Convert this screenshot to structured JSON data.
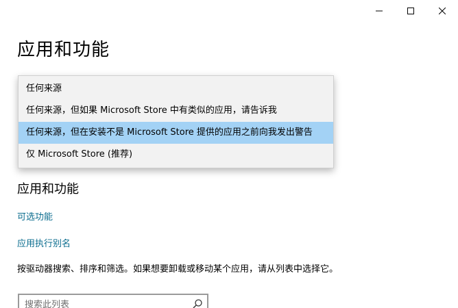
{
  "window": {
    "controls": [
      "minimize",
      "maximize",
      "close"
    ]
  },
  "page": {
    "title": "应用和功能"
  },
  "dropdown": {
    "options": [
      {
        "label": "任何来源",
        "selected": false
      },
      {
        "label": "任何来源，但如果 Microsoft Store 中有类似的应用，请告诉我",
        "selected": false
      },
      {
        "label": "任何来源，但在安装不是 Microsoft Store 提供的应用之前向我发出警告",
        "selected": true
      },
      {
        "label": "仅 Microsoft Store (推荐)",
        "selected": false
      }
    ],
    "highlight_color": "#a3d2f5"
  },
  "section": {
    "title": "应用和功能",
    "links": [
      "可选功能",
      "应用执行别名"
    ],
    "description": "按驱动器搜索、排序和筛选。如果想要卸载或移动某个应用，请从列表中选择它。"
  },
  "search": {
    "placeholder": "搜索此列表",
    "value": "",
    "icon": "search-icon"
  },
  "colors": {
    "link": "#0a6c8e",
    "accent": "#a3d2f5"
  }
}
